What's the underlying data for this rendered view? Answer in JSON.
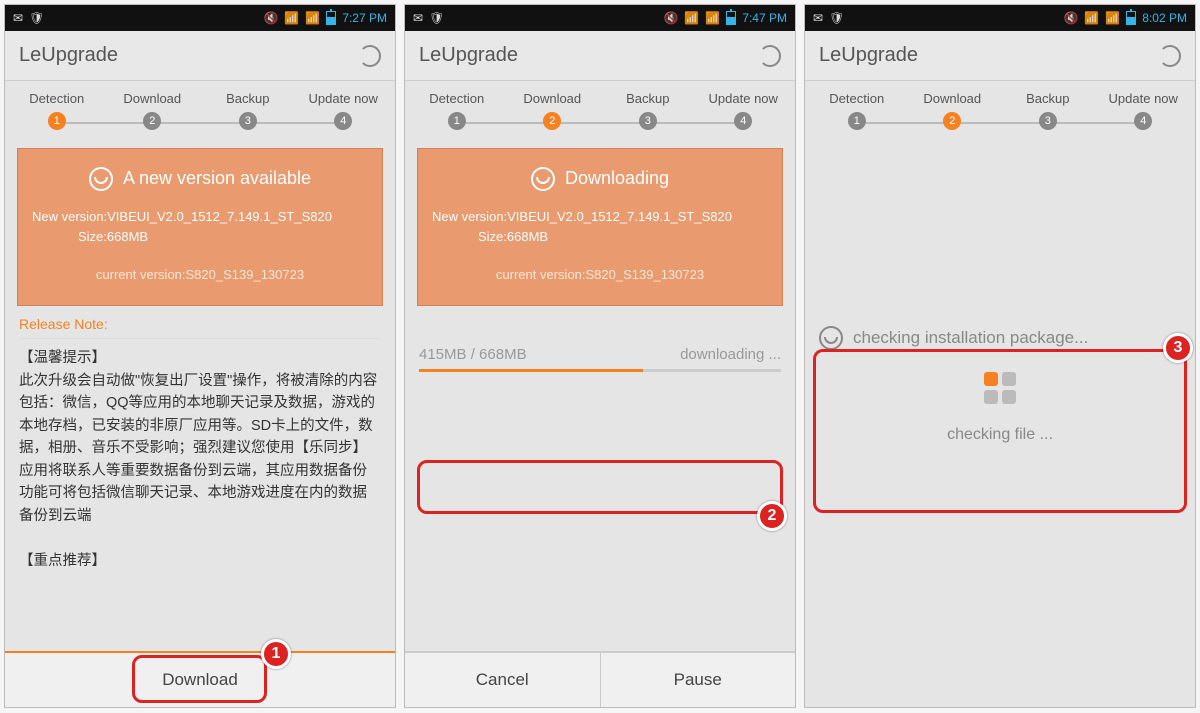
{
  "status": {
    "times": [
      "7:27 PM",
      "7:47 PM",
      "8:02 PM"
    ]
  },
  "app": {
    "title": "LeUpgrade"
  },
  "steps": [
    "Detection",
    "Download",
    "Backup",
    "Update now"
  ],
  "active_step": [
    1,
    2,
    2
  ],
  "card": {
    "title_avail": "A new version available",
    "title_downloading": "Downloading",
    "new_label": "New version:",
    "new_version": "VIBEUI_V2.0_1512_7.149.1_ST_S820",
    "size_label": "Size:",
    "size": "668MB",
    "current_label": "current version:",
    "current_version": "S820_S139_130723"
  },
  "release": {
    "label": "Release Note:"
  },
  "notes": "【温馨提示】\n此次升级会自动做\"恢复出厂设置\"操作，将被清除的内容包括：微信，QQ等应用的本地聊天记录及数据，游戏的本地存档，已安装的非原厂应用等。SD卡上的文件，数据，相册、音乐不受影响；强烈建议您使用【乐同步】应用将联系人等重要数据备份到云端，其应用数据备份功能可将包括微信聊天记录、本地游戏进度在内的数据备份到云端\n\n【重点推荐】",
  "buttons": {
    "download": "Download",
    "cancel": "Cancel",
    "pause": "Pause"
  },
  "progress": {
    "done": "415MB",
    "total": "668MB",
    "status": "downloading ...",
    "percent": 62
  },
  "check": {
    "title": "checking installation package...",
    "status": "checking file ..."
  },
  "badges": {
    "1": "1",
    "2": "2",
    "3": "3"
  }
}
